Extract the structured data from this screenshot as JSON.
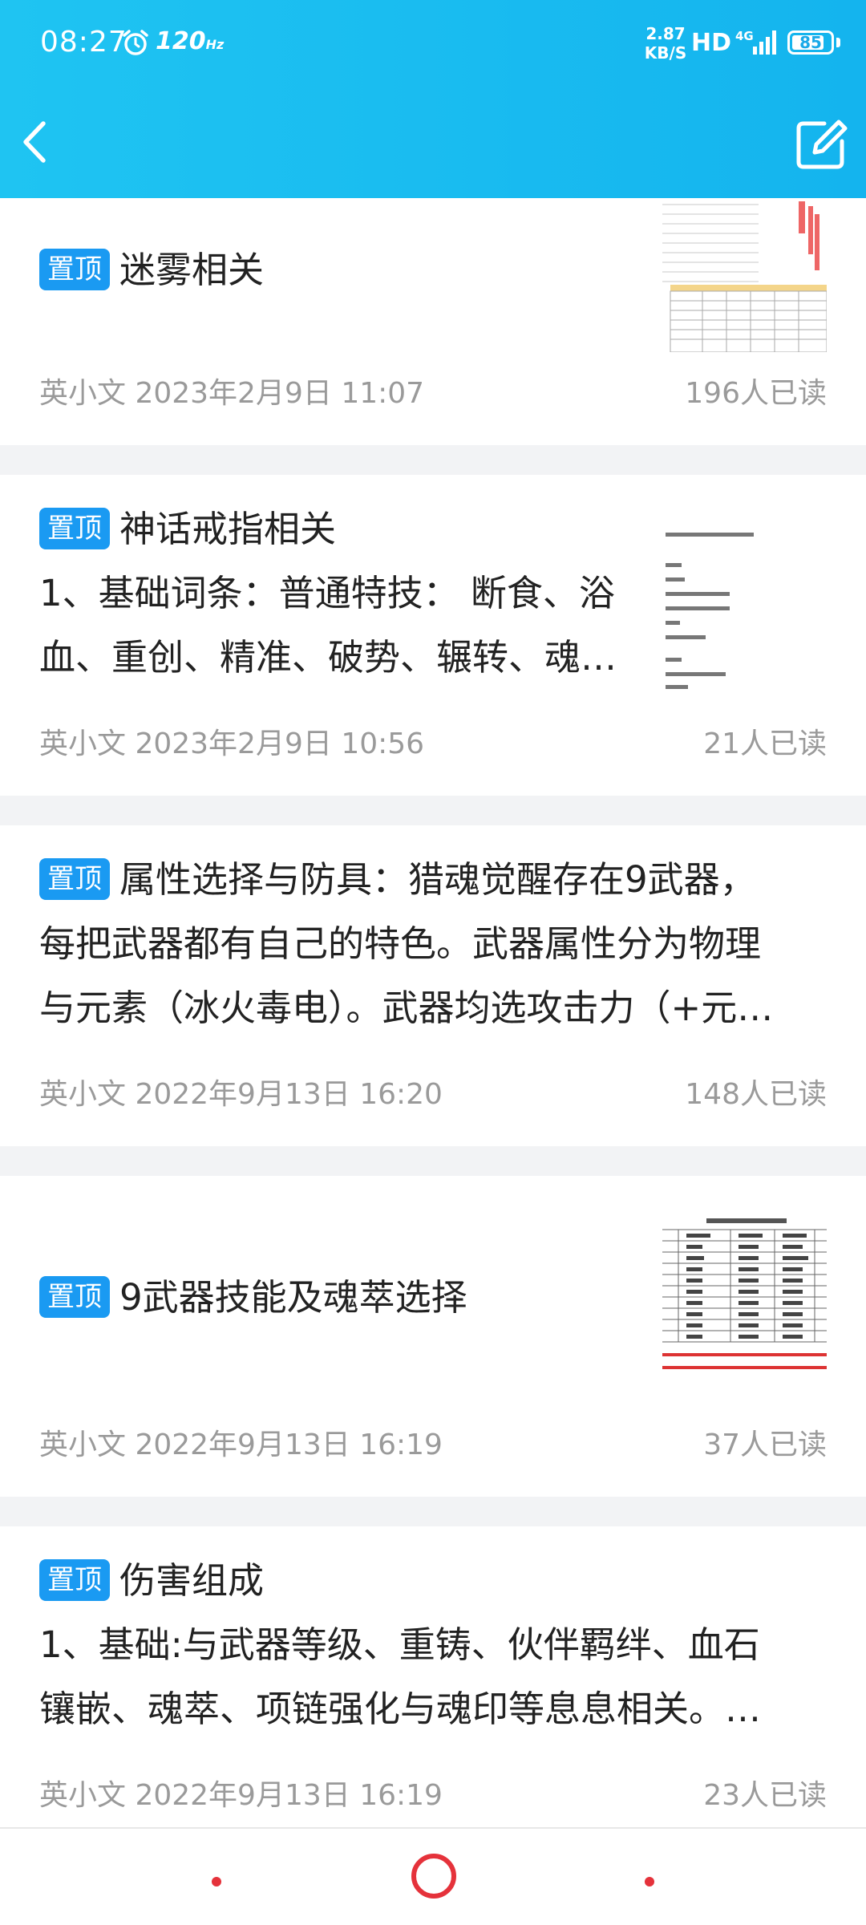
{
  "status_bar": {
    "time": "08:27",
    "refresh_rate": "120",
    "refresh_unit": "Hz",
    "net_speed_value": "2.87",
    "net_speed_unit": "KB/S",
    "hd_label": "HD",
    "network_type": "4G",
    "battery_level": "85"
  },
  "header": {
    "back_icon": "chevron-left-icon",
    "edit_icon": "edit-icon"
  },
  "colors": {
    "header_start": "#1fc4f2",
    "header_end": "#14b4ee",
    "pin_badge": "#1a9af2",
    "nav_accent": "#e5323b"
  },
  "posts": [
    {
      "pin_label": "置顶",
      "title": "迷雾相关",
      "body": [],
      "author_date": "英小文 2023年2月9日 11:07",
      "reads": "196人已读",
      "has_thumbnail": true
    },
    {
      "pin_label": "置顶",
      "title": "神话戒指相关",
      "body": [
        "1、基础词条：普通特技： 断食、浴",
        "血、重创、精准、破势、辗转、魂…"
      ],
      "author_date": "英小文 2023年2月9日 10:56",
      "reads": "21人已读",
      "has_thumbnail": true
    },
    {
      "pin_label": "置顶",
      "title": "属性选择与防具：猎魂觉醒存在9武器，",
      "body": [
        "每把武器都有自己的特色。武器属性分为物理",
        "与元素（冰火毒电）。武器均选攻击力（+元…"
      ],
      "author_date": "英小文 2022年9月13日 16:20",
      "reads": "148人已读",
      "has_thumbnail": false
    },
    {
      "pin_label": "置顶",
      "title": "9武器技能及魂萃选择",
      "body": [],
      "author_date": "英小文 2022年9月13日 16:19",
      "reads": "37人已读",
      "has_thumbnail": true
    },
    {
      "pin_label": "置顶",
      "title": "伤害组成",
      "body": [
        "1、基础:与武器等级、重铸、伙伴羁绊、血石",
        "镶嵌、魂萃、项链强化与魂印等息息相关。…"
      ],
      "author_date": "英小文 2022年9月13日 16:19",
      "reads": "23人已读",
      "has_thumbnail": false
    }
  ],
  "nav_bar": {
    "left_icon": "recent-dot-icon",
    "center_icon": "home-circle-icon",
    "right_icon": "back-dot-icon"
  }
}
